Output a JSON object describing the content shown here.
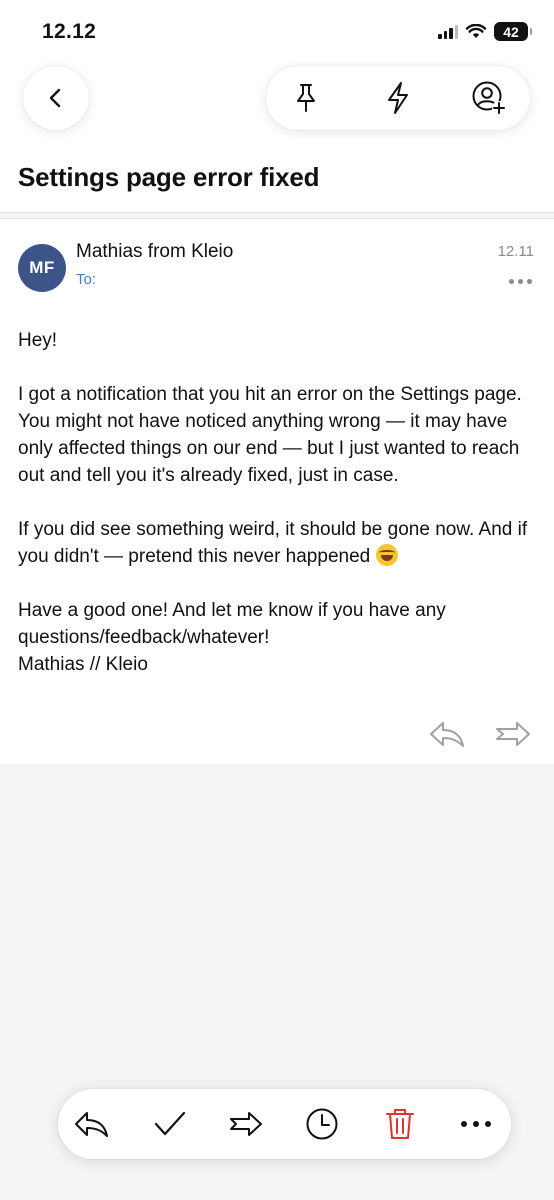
{
  "status_bar": {
    "time": "12.12",
    "battery": "42"
  },
  "header": {
    "subject": "Settings page error fixed"
  },
  "message": {
    "avatar_initials": "MF",
    "avatar_color": "#3d5488",
    "sender": "Mathias from Kleio",
    "to_label": "To:",
    "time": "12.11",
    "paragraphs": [
      "Hey!",
      "I got a notification that you hit an error on the Settings page. You might not have noticed anything wrong — it may have only affected things on our end — but I just wanted to reach out and tell you it's already fixed, just in case.",
      "If you did see something weird, it should be gone now. And if you didn't — pretend this never happened",
      "Have a good one! And let me know if you have any questions/feedback/whatever!\nMathias // Kleio"
    ]
  },
  "icons": {
    "top_actions": [
      "back-icon",
      "pin-icon",
      "lightning-icon",
      "add-contact-icon"
    ],
    "card_actions": [
      "reply-icon",
      "forward-icon"
    ],
    "toolbar": [
      "reply-all-icon",
      "checkmark-icon",
      "forward-icon",
      "clock-icon",
      "trash-icon",
      "more-icon"
    ]
  },
  "colors": {
    "accent": "#3d82d0",
    "delete": "#e0342b"
  }
}
